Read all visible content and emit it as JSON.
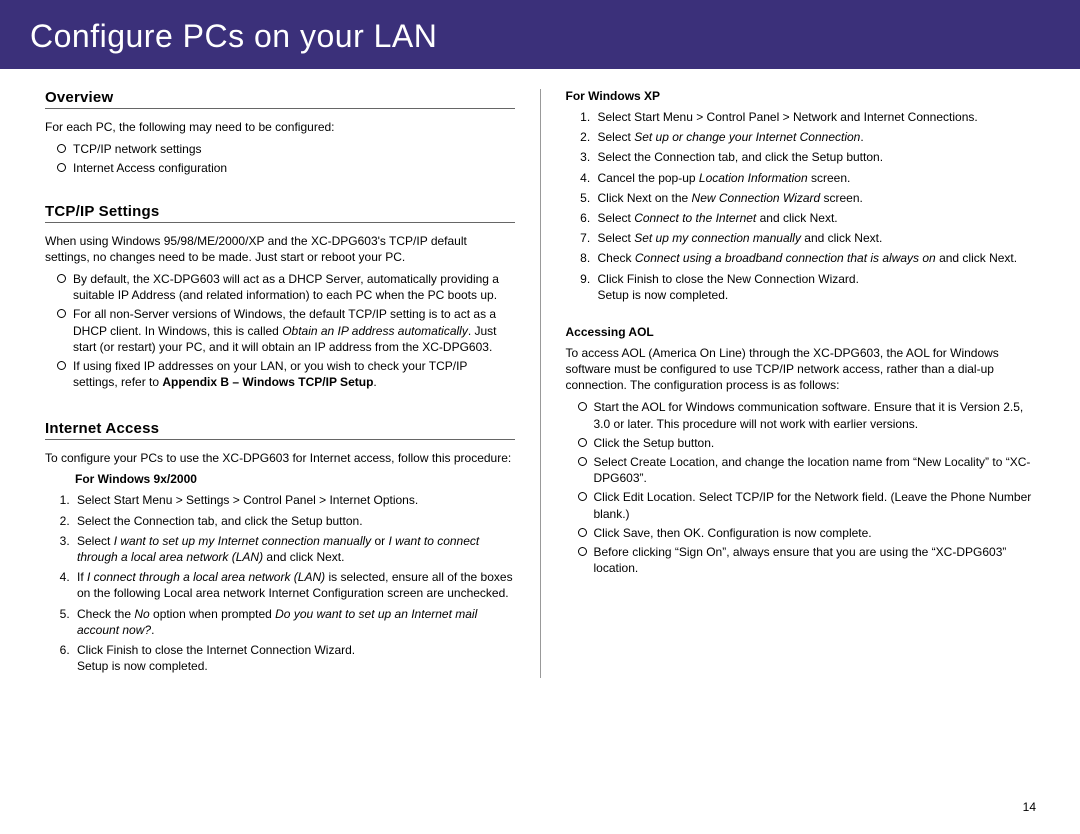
{
  "header": {
    "title": "Configure PCs on your LAN"
  },
  "page_number": "14",
  "left": {
    "overview": {
      "title": "Overview",
      "intro": "For each PC, the following may need to be configured:",
      "items": [
        "TCP/IP network settings",
        "Internet Access configuration"
      ]
    },
    "tcpip": {
      "title": "TCP/IP Settings",
      "intro": "When using Windows 95/98/ME/2000/XP and the XC-DPG603's TCP/IP default settings, no changes need to be made. Just start or reboot your PC.",
      "b1": "By default, the XC-DPG603 will act as a DHCP Server, automatically providing a suitable IP Address (and related information) to each PC when the PC boots up.",
      "b2a": "For all non-Server versions of Windows, the default TCP/IP setting is to act as a DHCP client. In Windows, this is called ",
      "b2i": "Obtain an IP address automatically",
      "b2b": ". Just start (or restart) your PC, and it will obtain an IP address from the XC-DPG603.",
      "b3a": "If using fixed IP addresses on your LAN, or you wish to check your TCP/IP settings, refer to ",
      "b3b": "Appendix B – Windows TCP/IP Setup",
      "b3c": "."
    },
    "internet": {
      "title": "Internet Access",
      "intro": "To configure your PCs to use the XC-DPG603 for Internet access, follow this procedure:",
      "win9x_title": "For Windows 9x/2000",
      "s1": "Select Start Menu > Settings > Control Panel > Internet Options.",
      "s2": "Select the Connection tab, and click the Setup button.",
      "s3a": "Select ",
      "s3i1": "I want to set up my Internet connection manually",
      "s3mid": " or ",
      "s3i2": "I want to connect through a local area network (LAN)",
      "s3b": " and click Next.",
      "s4a": "If ",
      "s4i": "I connect through a local area network (LAN)",
      "s4b": " is selected, ensure all of the boxes on the following Local area network Internet Configuration screen are unchecked.",
      "s5a": "Check the ",
      "s5i1": "No",
      "s5mid": " option when prompted ",
      "s5i2": "Do you want to set up an Internet mail account now?",
      "s5b": ".",
      "s6a": "Click Finish to close the Internet Connection Wizard.",
      "s6b": "Setup is now completed."
    }
  },
  "right": {
    "winxp": {
      "title": "For Windows XP",
      "s1": "Select Start Menu > Control Panel > Network and Internet Connections.",
      "s2a": "Select ",
      "s2i": "Set up or change your Internet Connection",
      "s2b": ".",
      "s3": "Select the Connection tab, and click the Setup button.",
      "s4a": "Cancel the pop-up ",
      "s4i": "Location Information",
      "s4b": " screen.",
      "s5a": "Click Next on the ",
      "s5i": "New Connection Wizard",
      "s5b": " screen.",
      "s6a": "Select ",
      "s6i": "Connect to the Internet",
      "s6b": " and click Next.",
      "s7a": "Select ",
      "s7i": "Set up my connection manually",
      "s7b": " and click Next.",
      "s8a": "Check ",
      "s8i": "Connect using a broadband connection that is always on",
      "s8b": " and click Next.",
      "s9a": "Click Finish to close the New Connection Wizard.",
      "s9b": "Setup is now completed."
    },
    "aol": {
      "title": "Accessing AOL",
      "intro": "To access AOL (America On Line) through the XC-DPG603, the AOL for Windows software must be configured to use TCP/IP network access, rather than a dial-up connection. The configuration process is as follows:",
      "b1": "Start the AOL for Windows communication software. Ensure that it is Version 2.5, 3.0 or later. This procedure will not work with earlier versions.",
      "b2": "Click the Setup button.",
      "b3": "Select Create Location, and change the location name from “New Locality” to “XC-DPG603”.",
      "b4": "Click Edit Location. Select TCP/IP for the Network field. (Leave the Phone Number blank.)",
      "b5": "Click Save, then OK. Configuration is now complete.",
      "b6": "Before clicking “Sign On”, always ensure that you are using the “XC-DPG603” location."
    }
  }
}
